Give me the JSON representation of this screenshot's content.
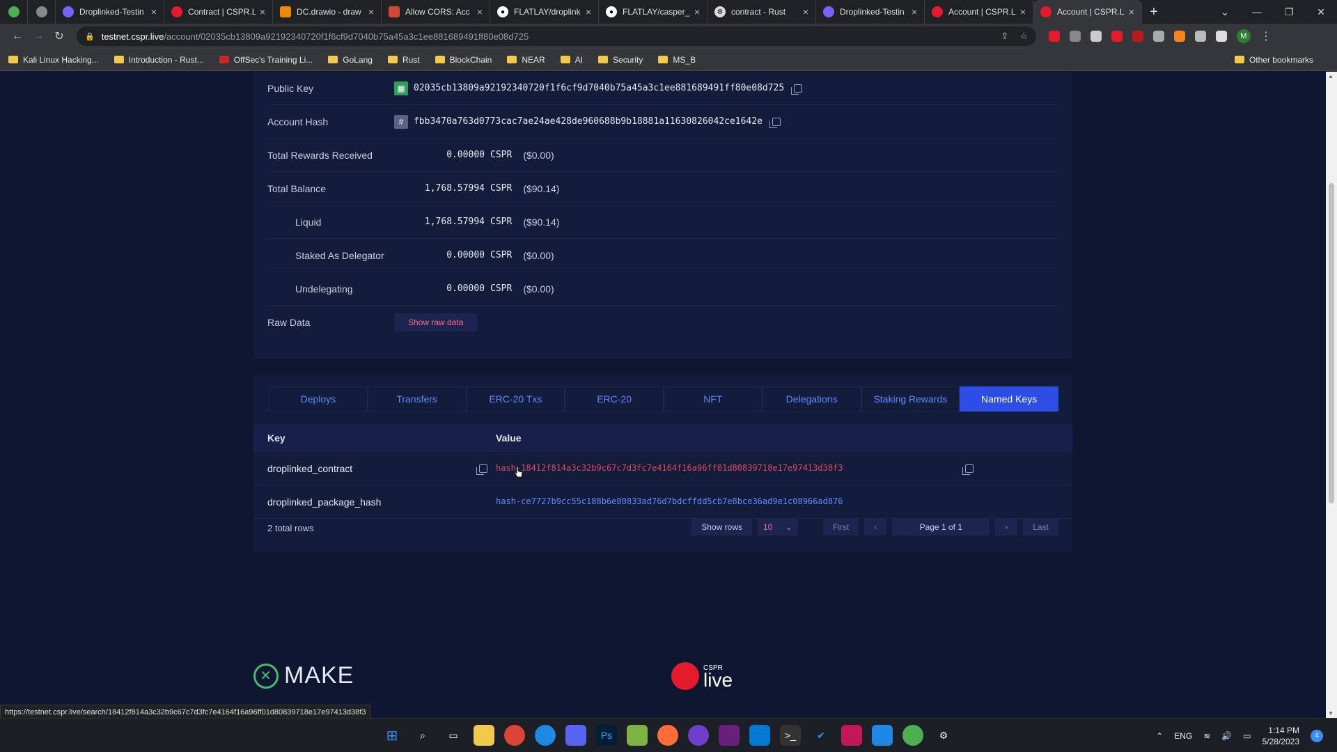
{
  "browser": {
    "tabs": [
      {
        "title": "",
        "color": "#4caf50",
        "pinned": true
      },
      {
        "title": "",
        "color": "#888888",
        "pinned": true
      },
      {
        "title": "Droplinked-Testin",
        "color": "#7b61ff"
      },
      {
        "title": "Contract | CSPR.L",
        "color": "#e41b2d"
      },
      {
        "title": "DC.drawio - draw",
        "color": "#f08705"
      },
      {
        "title": "Allow CORS: Acc",
        "color": "#d14836"
      },
      {
        "title": "FLATLAY/droplink",
        "color": "#ffffff"
      },
      {
        "title": "FLATLAY/casper_",
        "color": "#ffffff"
      },
      {
        "title": "contract - Rust",
        "color": "#dddddd"
      },
      {
        "title": "Droplinked-Testin",
        "color": "#7b61ff"
      },
      {
        "title": "Account | CSPR.L",
        "color": "#e41b2d"
      },
      {
        "title": "Account | CSPR.L",
        "color": "#e41b2d",
        "active": true
      }
    ],
    "url_host": "testnet.cspr.live",
    "url_path": "/account/02035cb13809a92192340720f1f6cf9d7040b75a45a3c1ee881689491ff80e08d725",
    "bookmarks": [
      "Kali Linux Hacking...",
      "Introduction - Rust...",
      "OffSec's Training Li...",
      "GoLang",
      "Rust",
      "BlockChain",
      "NEAR",
      "AI",
      "Security",
      "MS_B"
    ],
    "other_bookmarks": "Other bookmarks",
    "profile_initial": "M"
  },
  "account": {
    "public_key_label": "Public Key",
    "public_key": "02035cb13809a92192340720f1f6cf9d7040b75a45a3c1ee881689491ff80e08d725",
    "account_hash_label": "Account Hash",
    "account_hash": "fbb3470a763d0773cac7ae24ae428de960688b9b18881a11630826042ce1642e",
    "rows": [
      {
        "label": "Total Rewards Received",
        "amount": "0.00000",
        "unit": "CSPR",
        "usd": "($0.00)",
        "indent": false
      },
      {
        "label": "Total Balance",
        "amount": "1,768.57994",
        "unit": "CSPR",
        "usd": "($90.14)",
        "indent": false
      },
      {
        "label": "Liquid",
        "amount": "1,768.57994",
        "unit": "CSPR",
        "usd": "($90.14)",
        "indent": true
      },
      {
        "label": "Staked As Delegator",
        "amount": "0.00000",
        "unit": "CSPR",
        "usd": "($0.00)",
        "indent": true
      },
      {
        "label": "Undelegating",
        "amount": "0.00000",
        "unit": "CSPR",
        "usd": "($0.00)",
        "indent": true
      }
    ],
    "raw_data_label": "Raw Data",
    "show_raw_button": "Show raw data"
  },
  "named_keys": {
    "tabs": [
      "Deploys",
      "Transfers",
      "ERC-20 Txs",
      "ERC-20",
      "NFT",
      "Delegations",
      "Staking Rewards",
      "Named Keys"
    ],
    "active_tab": "Named Keys",
    "col_key": "Key",
    "col_value": "Value",
    "rows": [
      {
        "key": "droplinked_contract",
        "value": "hash-18412f814a3c32b9c67c7d3fc7e4164f16a96ff01d80839718e17e97413d38f3",
        "value_color": "#e0495c"
      },
      {
        "key": "droplinked_package_hash",
        "value": "hash-ce7727b9cc55c188b6e80833ad76d7bdcffdd5cb7e8bce36ad9e1c08966ad876",
        "value_color": "#5d8bff"
      }
    ],
    "total_rows": "2 total rows",
    "show_rows_label": "Show rows",
    "show_rows_value": "10",
    "first": "First",
    "page_text": "Page 1 of 1",
    "last": "Last"
  },
  "footer": {
    "make": "MAKE",
    "cspr_small": "CSPR",
    "cspr_big": "live"
  },
  "status_url": "https://testnet.cspr.live/search/18412f814a3c32b9c67c7d3fc7e4164f16a96ff01d80839718e17e97413d38f3",
  "taskbar": {
    "lang": "ENG",
    "time": "1:14 PM",
    "date": "5/28/2023",
    "notif_count": "4"
  }
}
